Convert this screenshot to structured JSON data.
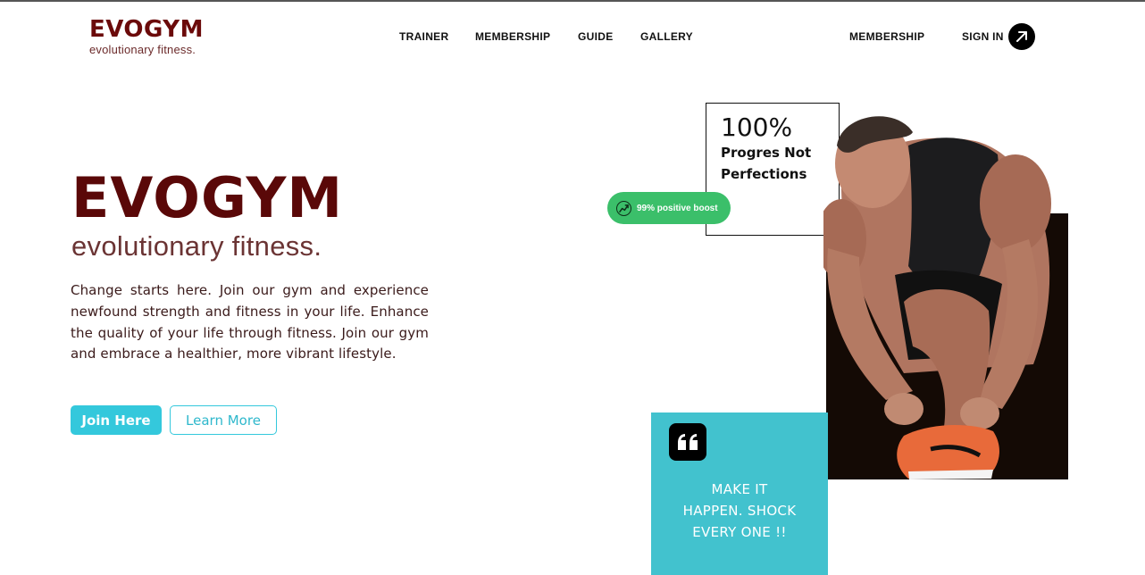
{
  "brand": {
    "name": "EVOGYM",
    "tagline": "evolutionary fitness.",
    "primary_color": "#6b0a0a",
    "accent_color": "#34c8dc"
  },
  "nav": {
    "items": [
      "TRAINER",
      "MEMBERSHIP",
      "GUIDE",
      "GALLERY"
    ],
    "right_link": "MEMBERSHIP",
    "sign_in": "SIGN IN",
    "sign_in_icon": "arrow-up-right-icon"
  },
  "hero": {
    "title": "EVOGYM",
    "subtitle": "evolutionary fitness.",
    "description": "Change starts here. Join our gym and experience newfound strength and fitness in your life. Enhance the quality of your life through fitness. Join our gym and embrace a healthier, more vibrant lifestyle.",
    "primary_button": "Join Here",
    "secondary_button": "Learn More"
  },
  "stat_card": {
    "value": "100%",
    "line1": "Progres Not",
    "line2": "Perfections"
  },
  "boost_badge": {
    "text": "99% positive boost",
    "icon": "trending-up-icon",
    "color": "#3bbf6a"
  },
  "quote_card": {
    "icon": "quote-icon",
    "line1": "MAKE IT",
    "line2": "HAPPEN. SHOCK",
    "line3": "EVERY ONE !!",
    "color": "#42c2ce"
  }
}
